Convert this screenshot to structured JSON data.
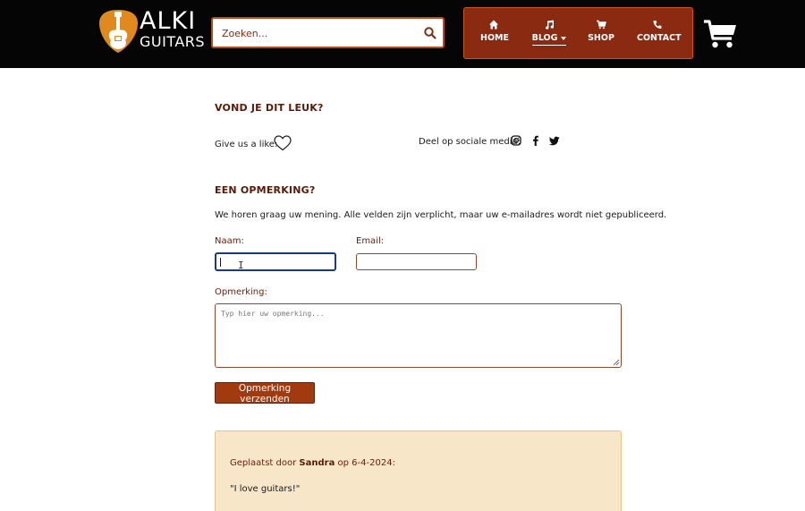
{
  "header": {
    "logo": {
      "line1": "ALKI",
      "line2": "GUITARS"
    },
    "search": {
      "placeholder": "Zoeken...",
      "value": ""
    },
    "nav": [
      {
        "label": "HOME",
        "icon": "home-icon"
      },
      {
        "label": "BLOG",
        "icon": "music-note-icon",
        "active": true,
        "dropdown": true
      },
      {
        "label": "SHOP",
        "icon": "cart-icon"
      },
      {
        "label": "CONTACT",
        "icon": "phone-icon"
      }
    ],
    "cart_icon": "shopping-cart-icon"
  },
  "like_section": {
    "heading": "VOND JE DIT LEUK?",
    "like_label": "Give us a like:",
    "share_label": "Deel op sociale media:",
    "social": [
      "instagram-icon",
      "facebook-icon",
      "twitter-icon"
    ]
  },
  "comment_form": {
    "heading": "EEN OPMERKING?",
    "intro": "We horen graag uw mening. Alle velden zijn verplicht, maar uw e-mailadres wordt niet gepubliceerd.",
    "name_label": "Naam:",
    "name_value": "",
    "email_label": "Email:",
    "email_value": "",
    "comment_label": "Opmerking:",
    "comment_placeholder": "Typ hier uw opmerking...",
    "submit_label": "Opmerking verzenden"
  },
  "comments": [
    {
      "prefix": "Geplaatst door",
      "author": "Sandra",
      "middle": "op",
      "date": "6-4-2024:",
      "text": "\"I love guitars!\""
    }
  ],
  "colors": {
    "header_bg": "#050505",
    "accent": "#8a2a10",
    "heading": "#5a1a08",
    "button": "#a23a10",
    "comment_bg": "#f7e6c8"
  }
}
